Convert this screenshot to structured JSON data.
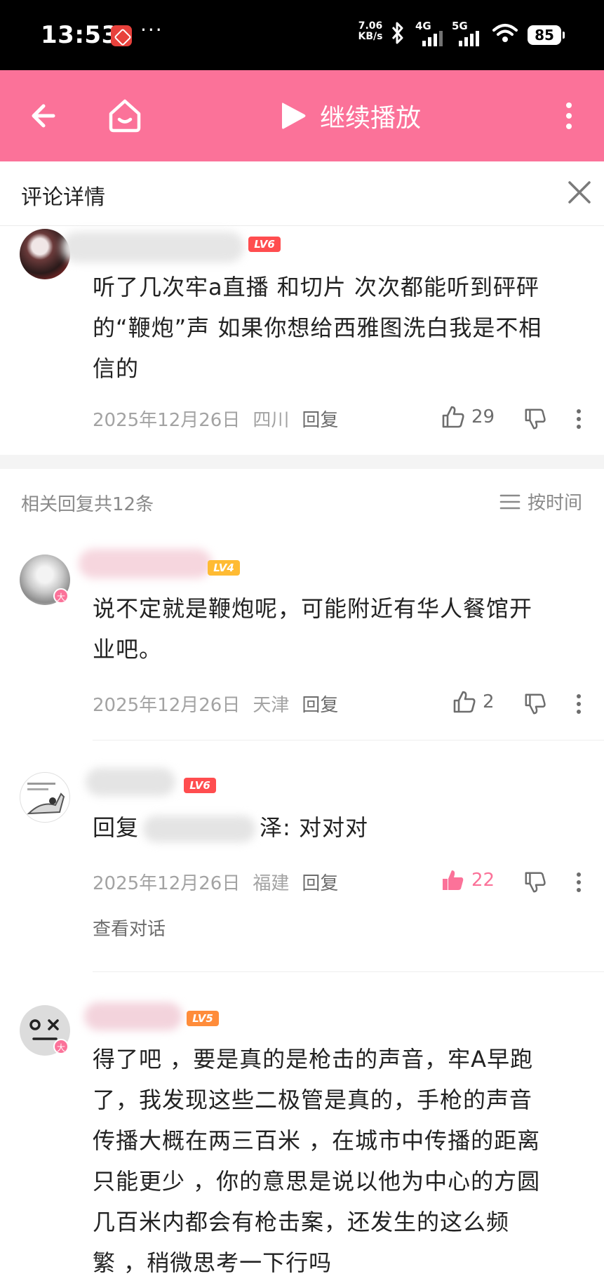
{
  "status_bar": {
    "time": "13:53",
    "more": "···",
    "speed_value": "7.06",
    "speed_unit": "KB/s",
    "network_1": "4G",
    "network_2": "5G",
    "battery": "85"
  },
  "header": {
    "play_label": "继续播放",
    "icons": [
      "back-arrow-icon",
      "home-tv-icon",
      "play-icon",
      "more-vertical-icon"
    ],
    "color": "#fb7299"
  },
  "subheader": {
    "title": "评论详情"
  },
  "main_comment": {
    "level": "LV6",
    "text_lines": [
      "听了几次牢a直播 和切片 次次都能听到砰砰",
      "的“鞭炮”声 如果你想给西雅图洗白我是不相",
      "信的"
    ],
    "date": "2025年12月26日",
    "location": "四川",
    "reply": "回复",
    "likes": "29"
  },
  "replies_section": {
    "count_label": "相关回复共12条",
    "sort_label": "按时间"
  },
  "replies": [
    {
      "level": "LV4",
      "badge": "大",
      "text_lines": [
        "说不定就是鞭炮呢，可能附近有华人餐馆开",
        "业吧。"
      ],
      "date": "2025年12月26日",
      "location": "天津",
      "reply": "回复",
      "likes": "2"
    },
    {
      "level": "LV6",
      "reply_prefix": "回复",
      "reply_tail": "泽: 对对对",
      "date": "2025年12月26日",
      "location": "福建",
      "reply": "回复",
      "likes": "22",
      "liked": true,
      "view_conversation": "查看对话"
    },
    {
      "level": "LV5",
      "badge": "大",
      "text_lines": [
        "得了吧 ，要是真的是枪击的声音，牢A早跑",
        "了，我发现这些二极管是真的，手枪的声音",
        "传播大概在两三百米 ，在城市中传播的距离",
        "只能更少 ，你的意思是说以他为中心的方圆",
        "几百米内都会有枪击案，还发生的这么频",
        "繁 ，稍微思考一下行吗"
      ]
    }
  ],
  "colors": {
    "accent_pink": "#fb7299",
    "lv6": "#ff4d4f",
    "lv5": "#ff8c3a",
    "lv4": "#ffbb33"
  }
}
